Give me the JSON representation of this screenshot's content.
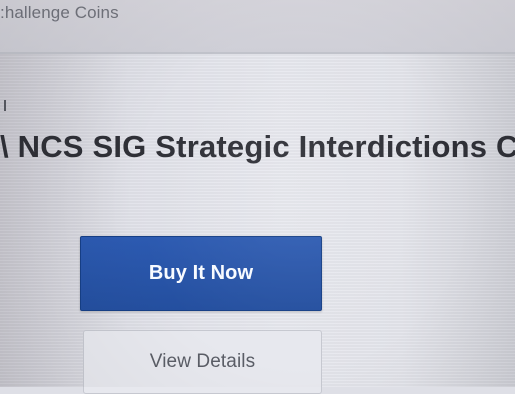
{
  "breadcrumb": {
    "label": ":hallenge Coins"
  },
  "product": {
    "title": "\\ NCS SIG Strategic Interdictions C"
  },
  "actions": {
    "buy_label": "Buy It Now",
    "view_label": "View Details"
  },
  "colors": {
    "primary_button": "#2555a6",
    "secondary_button": "#e7e8ee",
    "background": "#e4e5eb"
  }
}
